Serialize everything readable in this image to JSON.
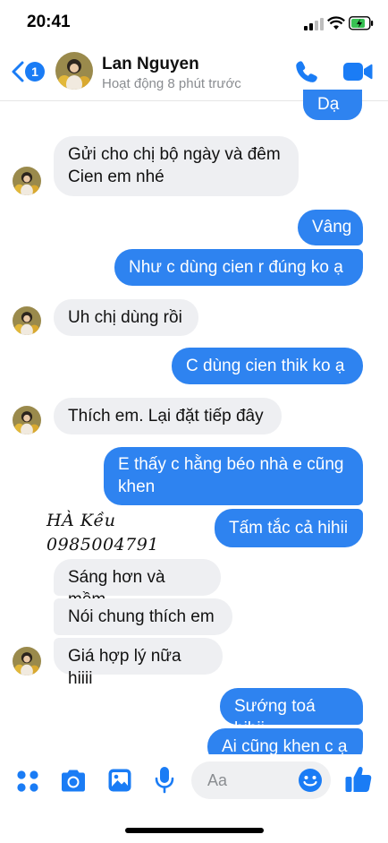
{
  "status_bar": {
    "time": "20:41"
  },
  "header": {
    "back_badge": "1",
    "name": "Lan Nguyen",
    "status": "Hoạt động 8 phút trước",
    "icons": [
      "phone-icon",
      "video-icon"
    ]
  },
  "messages": [
    {
      "from": "me",
      "text": "Dạ c"
    },
    {
      "from": "them",
      "text": "Gửi cho chị bộ ngày và đêm Cien em nhé",
      "lines": [
        "Gửi cho chị bộ ngày và đêm",
        "Cien em nhé"
      ]
    },
    {
      "from": "me",
      "text": "Vâng"
    },
    {
      "from": "me",
      "text": "Như c dùng cien r đúng ko ạ"
    },
    {
      "from": "them",
      "text": "Uh chị dùng rồi"
    },
    {
      "from": "me",
      "text": "C dùng cien thik ko ạ"
    },
    {
      "from": "them",
      "text": "Thích em. Lại đặt tiếp đây"
    },
    {
      "from": "me",
      "text": "E thấy c hằng béo nhà e cũng khen",
      "lines": [
        "E thấy c hằng béo nhà e cũng",
        "khen"
      ]
    },
    {
      "from": "me",
      "text": "Tấm tắc cả hihii"
    },
    {
      "from": "them",
      "text": "Sáng hơn và mềm"
    },
    {
      "from": "them",
      "text": "Nói chung thích em"
    },
    {
      "from": "them",
      "text": "Giá hợp lý nữa hiiii"
    },
    {
      "from": "me",
      "text": "Sướng toá hihii"
    },
    {
      "from": "me",
      "text": "Ai cũng khen c ạ"
    }
  ],
  "overlay_handwriting": {
    "line1": "HÀ Kều",
    "line2": "0985004791"
  },
  "composer": {
    "placeholder": "Aa",
    "icons": [
      "menu-dots-icon",
      "camera-icon",
      "gallery-icon",
      "microphone-icon",
      "emoji-icon",
      "thumbs-up-icon"
    ]
  },
  "colors": {
    "accent": "#1a7cf5",
    "outgoing_bubble": "#2e83f0",
    "incoming_bubble": "#eeeff2"
  }
}
